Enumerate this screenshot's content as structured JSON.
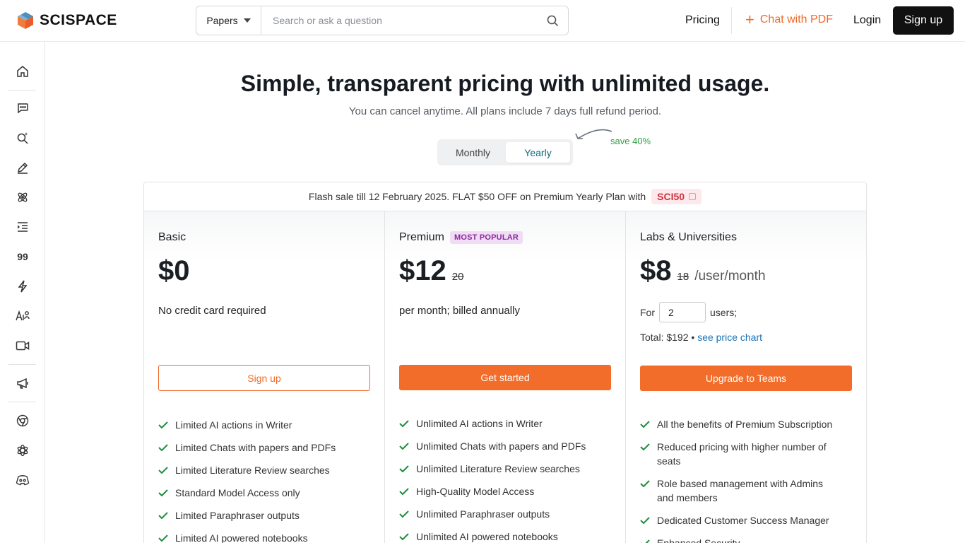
{
  "header": {
    "logo_text": "SCISPACE",
    "search_type": "Papers",
    "search_placeholder": "Search or ask a question",
    "nav": {
      "pricing": "Pricing",
      "chat_pdf": "Chat with PDF",
      "login": "Login",
      "signup": "Sign up"
    },
    "accent_color": "#f06a28"
  },
  "sidebar": {
    "items": [
      {
        "icon": "home-icon"
      },
      {
        "icon": "chat-bubble-icon"
      },
      {
        "icon": "search-sparkle-icon"
      },
      {
        "icon": "pen-icon"
      },
      {
        "icon": "atom-icon"
      },
      {
        "icon": "indent-list-icon"
      },
      {
        "icon": "quote-icon",
        "text": "99"
      },
      {
        "icon": "lightning-icon"
      },
      {
        "icon": "ai-detector-icon"
      },
      {
        "icon": "video-icon"
      },
      {
        "icon": "megaphone-icon"
      },
      {
        "icon": "chrome-icon"
      },
      {
        "icon": "openai-icon"
      },
      {
        "icon": "discord-icon"
      }
    ]
  },
  "main": {
    "title": "Simple, transparent pricing with unlimited usage.",
    "subtitle": "You can cancel anytime. All plans include 7 days full refund period.",
    "toggle": {
      "monthly": "Monthly",
      "yearly": "Yearly",
      "selected": "Yearly"
    },
    "save_note": "save 40%",
    "flash": {
      "text": "Flash sale till 12 February 2025. FLAT $50 OFF on Premium Yearly Plan with",
      "code": "SCI50"
    },
    "plans": {
      "basic": {
        "name": "Basic",
        "price": "$0",
        "note": "No credit card required",
        "button": "Sign up",
        "features": [
          "Limited AI actions in Writer",
          "Limited Chats with papers and PDFs",
          "Limited Literature Review searches",
          "Standard Model Access only",
          "Limited Paraphraser outputs",
          "Limited AI powered notebooks"
        ]
      },
      "premium": {
        "name": "Premium",
        "badge": "MOST POPULAR",
        "price": "$12",
        "old_price": "20",
        "note": "per month; billed annually",
        "button": "Get started",
        "features": [
          "Unlimited AI actions in Writer",
          "Unlimited Chats with papers and PDFs",
          "Unlimited Literature Review searches",
          "High-Quality Model Access",
          "Unlimited Paraphraser outputs",
          "Unlimited AI powered notebooks"
        ]
      },
      "teams": {
        "name": "Labs & Universities",
        "price": "$8",
        "old_price": "18",
        "unit": "/user/month",
        "users_prefix": "For",
        "users_value": "2",
        "users_suffix": "users;",
        "total": "Total: $192 •",
        "price_chart_link": "see price chart",
        "button": "Upgrade to Teams",
        "features": [
          "All the benefits of Premium Subscription",
          "Reduced pricing with higher number of seats",
          "Role based management with Admins and members",
          "Dedicated Customer Success Manager",
          "Enhanced Security"
        ]
      }
    }
  }
}
